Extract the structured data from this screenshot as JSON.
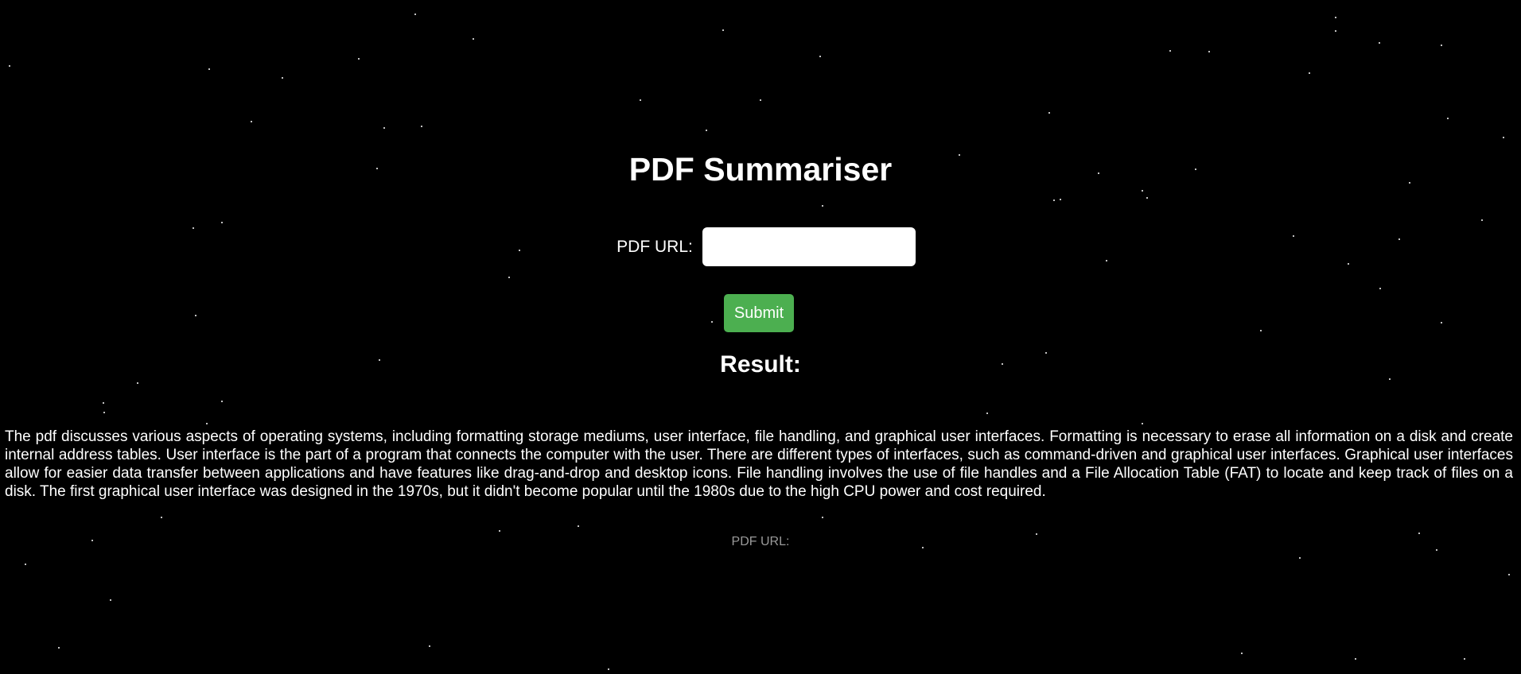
{
  "page": {
    "title": "PDF Summariser",
    "url_label": "PDF URL:",
    "url_value": "",
    "url_placeholder": "",
    "submit_label": "Submit",
    "result_heading": "Result:",
    "result_text": "The pdf discusses various aspects of operating systems, including formatting storage mediums, user interface, file handling, and graphical user interfaces. Formatting is necessary to erase all information on a disk and create internal address tables. User interface is the part of a program that connects the computer with the user. There are different types of interfaces, such as command-driven and graphical user interfaces. Graphical user interfaces allow for easier data transfer between applications and have features like drag-and-drop and desktop icons. File handling involves the use of file handles and a File Allocation Table (FAT) to locate and keep track of files on a disk. The first graphical user interface was designed in the 1970s, but it didn't become popular until the 1980s due to the high CPU power and cost required.",
    "footer_label": "PDF URL:"
  },
  "colors": {
    "background": "#000000",
    "text": "#ffffff",
    "submit_button": "#4caf50",
    "footer_text": "#9a9a9a"
  }
}
